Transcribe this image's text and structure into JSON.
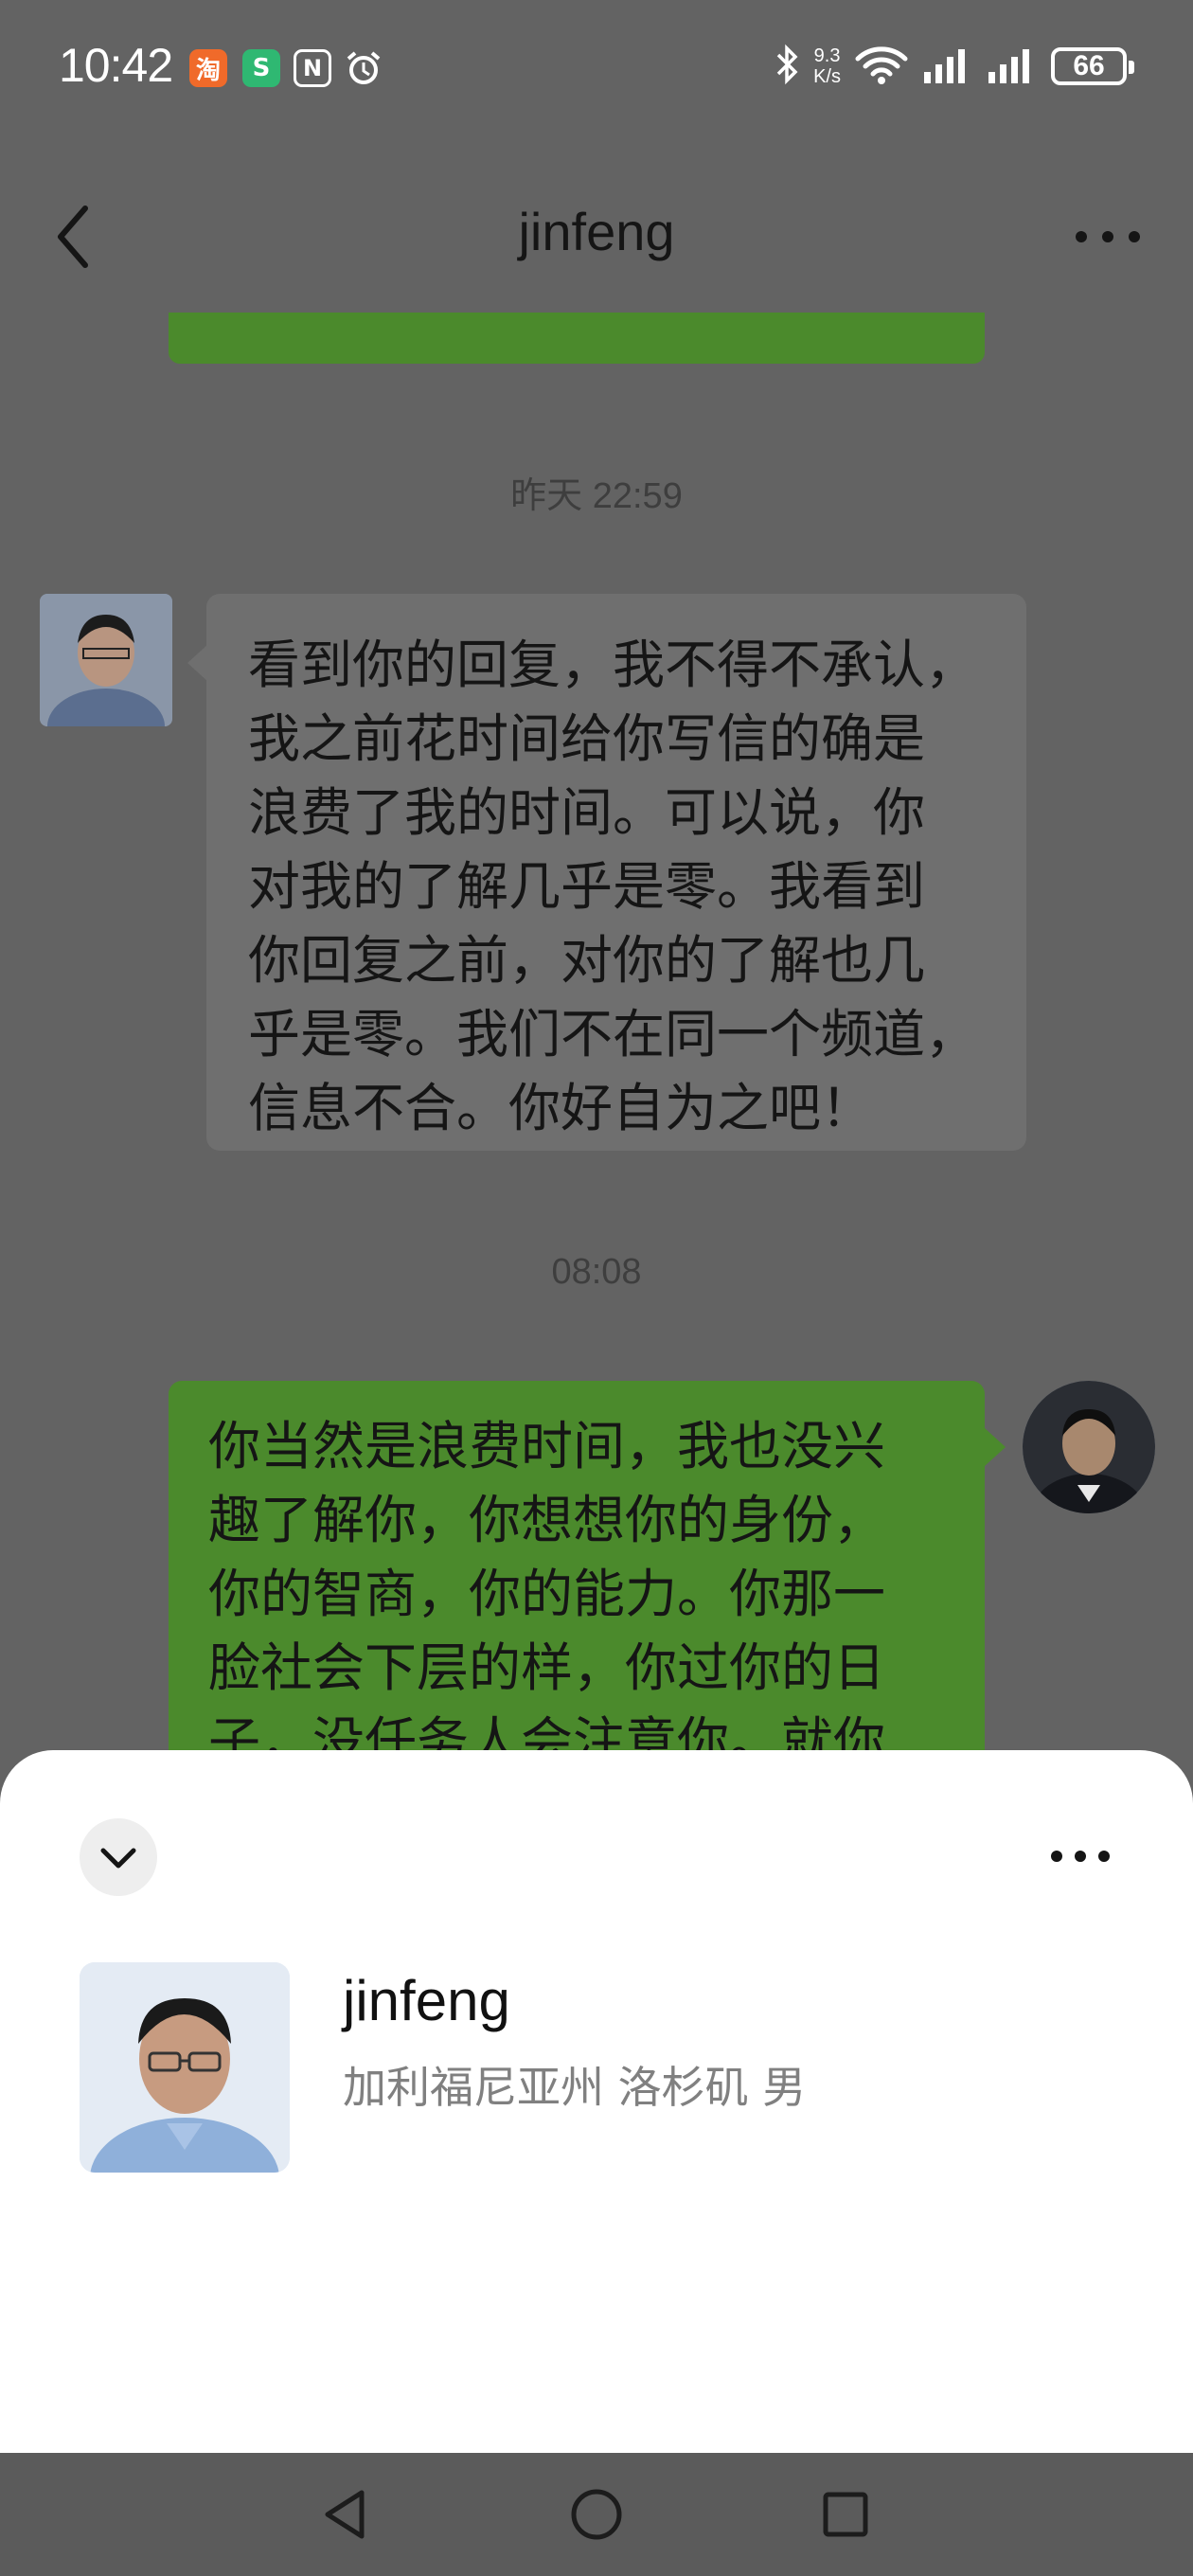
{
  "status_bar": {
    "time": "10:42",
    "app_icons": [
      "taobao-icon",
      "sogou-icon",
      "nfc-icon",
      "alarm-icon"
    ],
    "net_speed_value": "9.3",
    "net_speed_unit": "K/s",
    "wifi_label": "6",
    "battery": "66"
  },
  "header": {
    "title": "jinfeng"
  },
  "messages": [
    {
      "type": "timestamp",
      "text": "昨天 22:59"
    },
    {
      "type": "received",
      "text": "看到你的回复，我不得不承认，\n我之前花时间给你写信的确是\n浪费了我的时间。可以说，你\n对我的了解几乎是零。我看到\n你回复之前，对你的了解也几\n乎是零。我们不在同一个频道，\n信息不合。你好自为之吧！"
    },
    {
      "type": "timestamp",
      "text": "08:08"
    },
    {
      "type": "sent",
      "text": "你当然是浪费时间，我也没兴\n趣了解你，你想想你的身份，\n你的智商，你的能力。你那一\n脸社会下层的样，你过你的日\n子，没任务人会注意你。就你"
    }
  ],
  "profile_sheet": {
    "name": "jinfeng",
    "region": "加利福尼亚州 洛杉矶 男"
  },
  "colors": {
    "sent_bubble": "#4b8a2c",
    "received_bubble": "#6f6f6f",
    "overlay_bg": "#636363",
    "sheet_bg": "#ffffff"
  }
}
